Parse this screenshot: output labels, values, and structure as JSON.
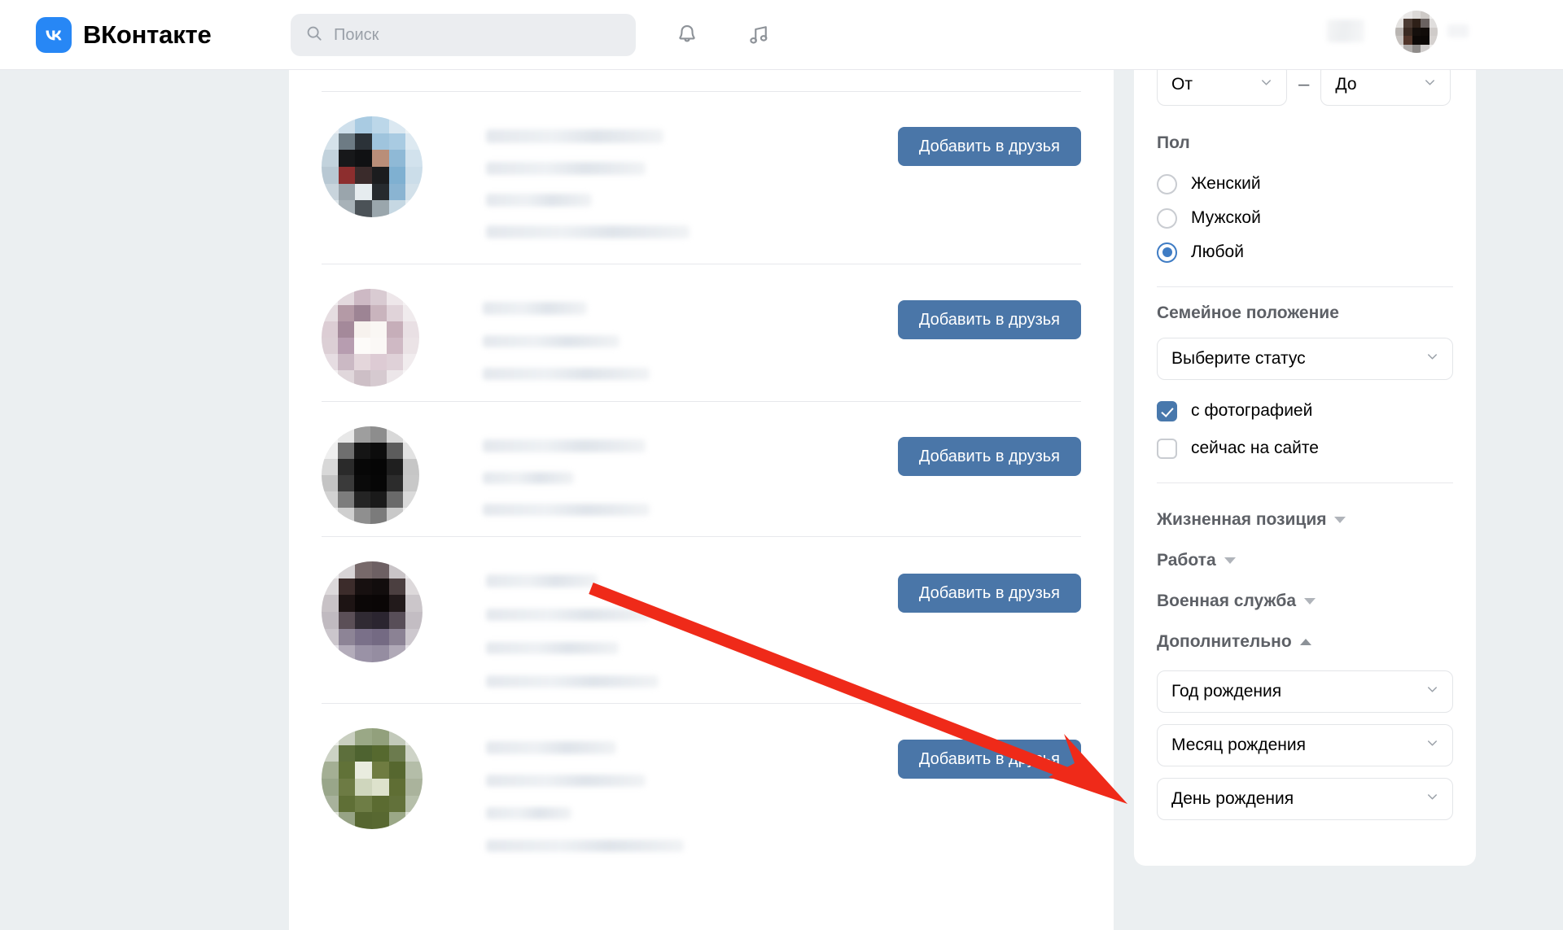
{
  "header": {
    "brand_name": "ВКонтакте",
    "logo_icon": "vk-logo-icon",
    "search": {
      "placeholder": "Поиск",
      "value": "",
      "icon": "search-icon"
    },
    "notifications_icon": "bell-icon",
    "music_icon": "music-note-icon",
    "avatar_icon": "user-avatar"
  },
  "results": {
    "add_friend_label": "Добавить в друзья",
    "rows": [
      {
        "avatar_name": "user-avatar-1",
        "avatar_tone": "light-blue"
      },
      {
        "avatar_name": "user-avatar-2",
        "avatar_tone": "pastel"
      },
      {
        "avatar_name": "user-avatar-3",
        "avatar_tone": "dark"
      },
      {
        "avatar_name": "user-avatar-4",
        "avatar_tone": "purple-dark"
      },
      {
        "avatar_name": "user-avatar-5",
        "avatar_tone": "green"
      }
    ]
  },
  "filters": {
    "age": {
      "from_label": "От",
      "to_label": "До",
      "separator": "–"
    },
    "gender": {
      "title": "Пол",
      "options": [
        {
          "label": "Женский",
          "selected": false
        },
        {
          "label": "Мужской",
          "selected": false
        },
        {
          "label": "Любой",
          "selected": true
        }
      ]
    },
    "relationship": {
      "title": "Семейное положение",
      "select_label": "Выберите статус"
    },
    "checkboxes": [
      {
        "label": "с фотографией",
        "checked": true
      },
      {
        "label": "сейчас на сайте",
        "checked": false
      }
    ],
    "collapsibles": [
      {
        "label": "Жизненная позиция",
        "expanded": false
      },
      {
        "label": "Работа",
        "expanded": false
      },
      {
        "label": "Военная служба",
        "expanded": false
      },
      {
        "label": "Дополнительно",
        "expanded": true
      }
    ],
    "additional_selects": [
      {
        "label": "Год рождения"
      },
      {
        "label": "Месяц рождения"
      },
      {
        "label": "День рождения"
      }
    ]
  },
  "annotation": {
    "arrow_color": "#ef2a19",
    "arrow_name": "red-pointer-arrow",
    "points_to": "Месяц рождения"
  },
  "colors": {
    "brand_blue": "#2787f5",
    "button_blue": "#4a76a8",
    "page_bg": "#ebeff1",
    "accent_check": "#4878ac",
    "arrow_red": "#ef2a19"
  }
}
